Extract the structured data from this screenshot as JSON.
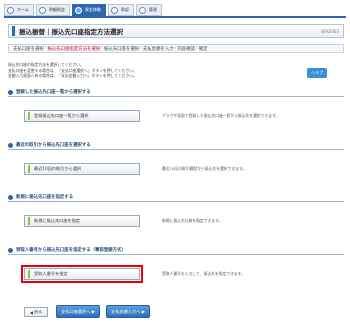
{
  "nav": {
    "tabs": [
      {
        "label": "ホーム",
        "icon": "home-icon",
        "active": false
      },
      {
        "label": "明細照会",
        "icon": "document-icon",
        "active": false
      },
      {
        "label": "資金移動",
        "icon": "transfer-icon",
        "active": true
      },
      {
        "label": "承認",
        "icon": "check-icon",
        "active": false
      },
      {
        "label": "管理",
        "icon": "manage-icon",
        "active": false
      }
    ]
  },
  "page": {
    "title": "振込振替｜振込先口座指定方法選択",
    "code": "BFKE003"
  },
  "steps": [
    {
      "label": "支払口座を選択",
      "current": false
    },
    {
      "label": "振込先口座指定方法を選択",
      "current": true
    },
    {
      "label": "振込先口座を選択",
      "current": false
    },
    {
      "label": "支払金額を入力",
      "current": false
    },
    {
      "label": "内容確認",
      "current": false
    },
    {
      "label": "確定",
      "current": false
    }
  ],
  "intro": [
    "振込先口座の指定方法を選択してください。",
    "支払口座を変更する場合は、「支払口座選択へ」ボタンを押してください。",
    "金額入力画面へ戻る場合は、「支払金額入力へ」ボタンを押してください。"
  ],
  "help_label": "ヘルプ",
  "sections": [
    {
      "heading": "登録した振込先口座一覧から選択する",
      "button": "登録振込先口座一覧から選択",
      "desc": "ブラウザ画面で登録した振込先口座一覧から振込先を選択できます。",
      "highlight": false
    },
    {
      "heading": "最近の取引から振込先口座を選択する",
      "button": "最近10回の取引から選択",
      "desc": "最近10回の取引履歴から振込先を選択できます。",
      "highlight": false
    },
    {
      "heading": "新規に振込先口座を指定する",
      "button": "新規に振込先口座を指定",
      "desc": "新規に振込先口座を指定できます。",
      "highlight": false
    },
    {
      "heading": "受取人番号から振込先口座を指定する（事前登録方式）",
      "button": "受取人番号を指定",
      "desc": "受取人番号を入力して、振込先を指定できます。",
      "highlight": true
    }
  ],
  "bottom": {
    "back": "戻る",
    "btn1": "支払口座選択へ",
    "btn2": "支払金額入力へ"
  },
  "colors": {
    "primary": "#2e67b1",
    "highlight": "#e60012",
    "accent": "#8cc63f"
  }
}
